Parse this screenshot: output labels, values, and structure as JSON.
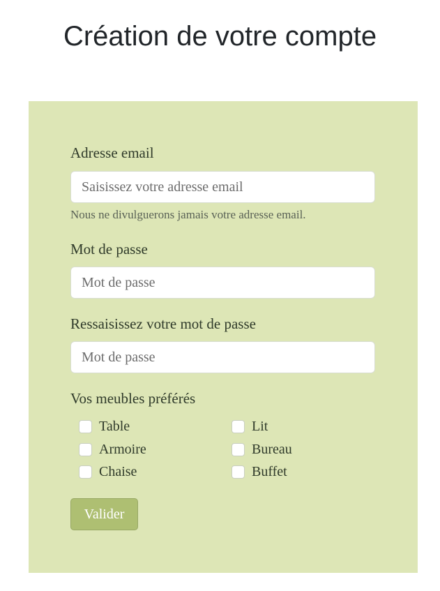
{
  "page": {
    "title": "Création de votre compte"
  },
  "form": {
    "email": {
      "label": "Adresse email",
      "placeholder": "Saisissez votre adresse email",
      "value": "",
      "help": "Nous ne divulguerons jamais votre adresse email."
    },
    "password": {
      "label": "Mot de passe",
      "placeholder": "Mot de passe",
      "value": ""
    },
    "password_confirm": {
      "label": "Ressaisissez votre mot de passe",
      "placeholder": "Mot de passe",
      "value": ""
    },
    "furniture": {
      "label": "Vos meubles préférés",
      "options": [
        {
          "label": "Table",
          "checked": false
        },
        {
          "label": "Lit",
          "checked": false
        },
        {
          "label": "Armoire",
          "checked": false
        },
        {
          "label": "Bureau",
          "checked": false
        },
        {
          "label": "Chaise",
          "checked": false
        },
        {
          "label": "Buffet",
          "checked": false
        }
      ]
    },
    "submit_label": "Valider"
  },
  "colors": {
    "panel_background": "#dde6b6",
    "button_background": "#aebf72",
    "title_text": "#212529"
  }
}
